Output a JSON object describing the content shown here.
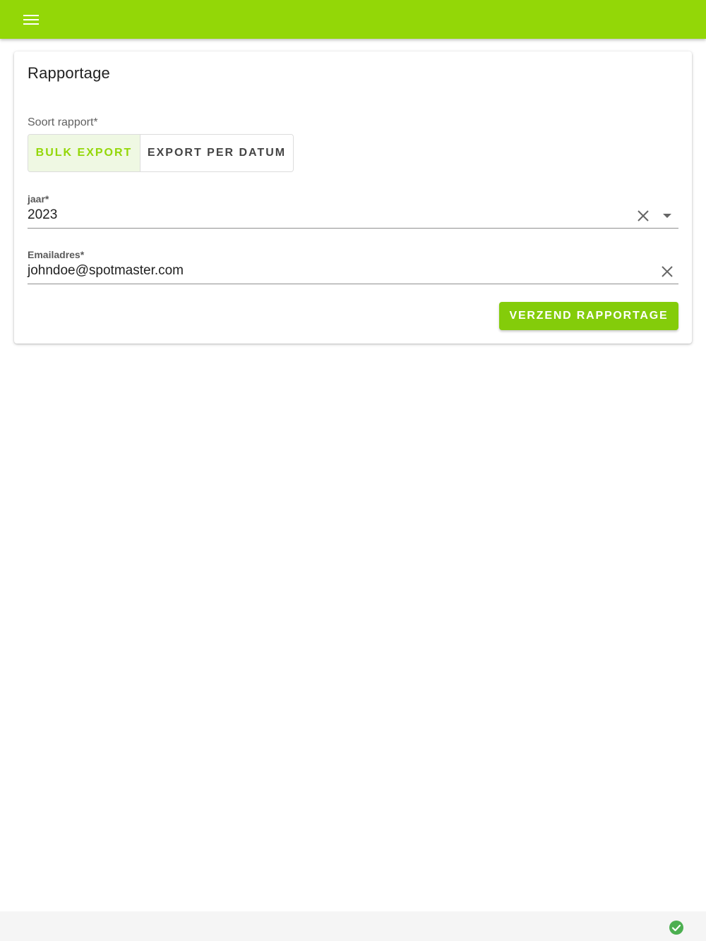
{
  "app_bar": {
    "menu_icon": "hamburger-menu-icon",
    "color": "#93d707"
  },
  "card": {
    "title": "Rapportage",
    "report_type": {
      "label": "Soort rapport*",
      "options": [
        "BULK EXPORT",
        "EXPORT PER DATUM"
      ],
      "selected": "BULK EXPORT"
    },
    "year_field": {
      "label": "jaar*",
      "value": "2023",
      "clear_icon": "close-icon",
      "dropdown_icon": "caret-down-icon"
    },
    "email_field": {
      "label": "Emailadres*",
      "value": "johndoe@spotmaster.com",
      "clear_icon": "close-icon"
    },
    "submit_label": "VERZEND RAPPORTAGE"
  },
  "footer": {
    "status_icon": "check-circle-icon",
    "status_color": "#4caf50"
  }
}
